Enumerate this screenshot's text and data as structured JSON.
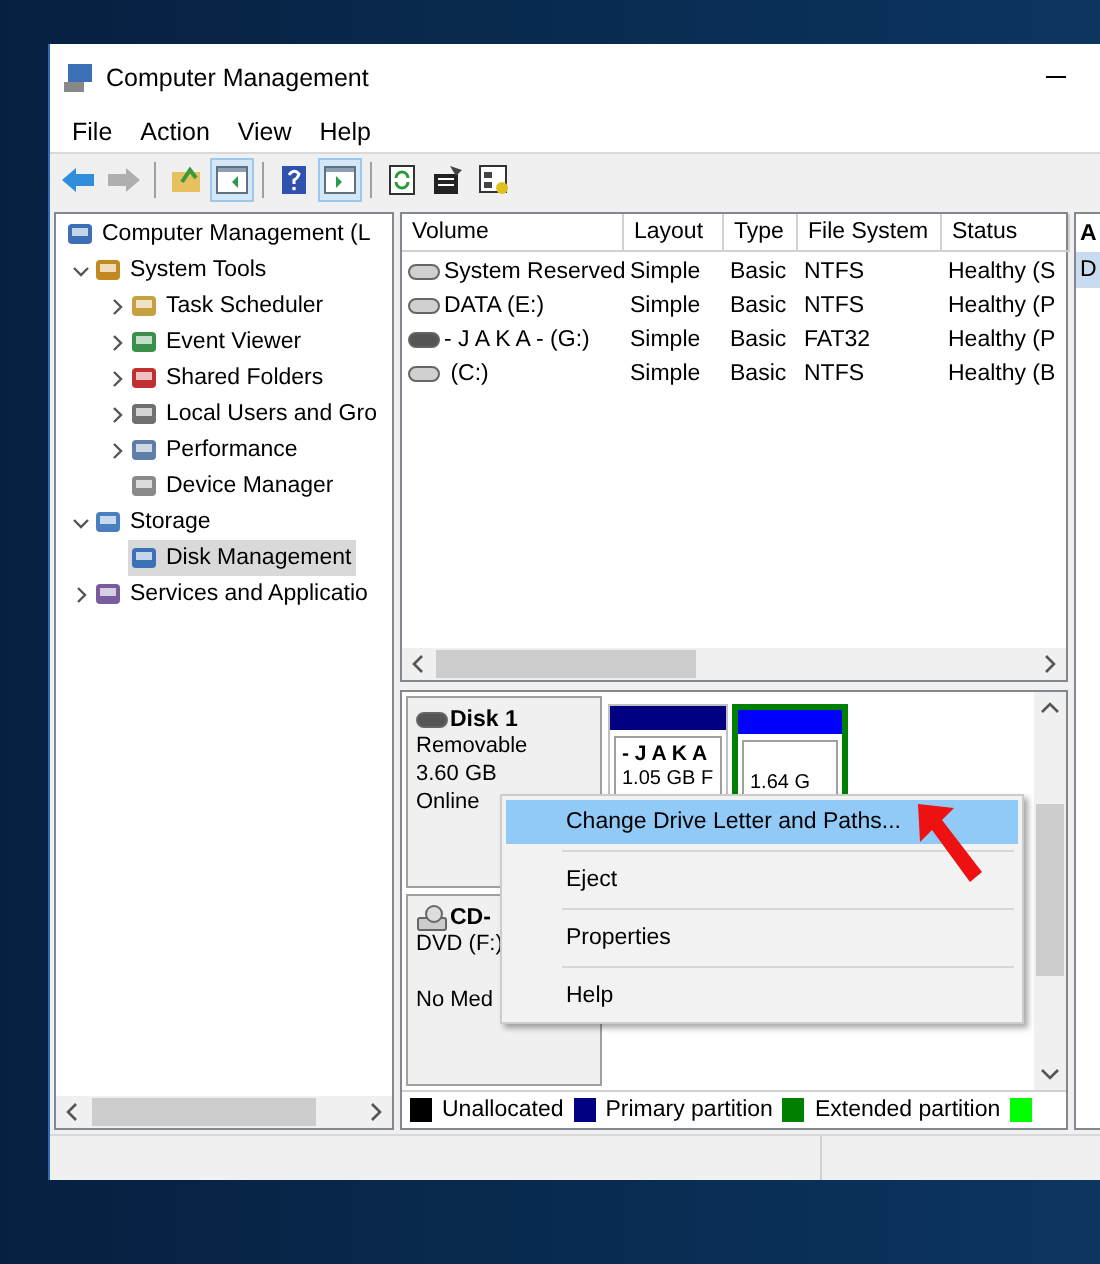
{
  "window": {
    "title": "Computer Management"
  },
  "menu": [
    "File",
    "Action",
    "View",
    "Help"
  ],
  "toolbar": [
    {
      "pressed": false,
      "disabled": false
    },
    {
      "pressed": false,
      "disabled": true
    },
    {
      "pressed": false,
      "disabled": false
    },
    {
      "pressed": true,
      "disabled": false
    },
    {
      "pressed": false,
      "disabled": false
    },
    {
      "pressed": true,
      "disabled": false
    },
    {
      "pressed": false,
      "disabled": false
    },
    {
      "pressed": false,
      "disabled": false
    },
    {
      "pressed": false,
      "disabled": false
    }
  ],
  "tree": [
    {
      "label": "Computer Management (L",
      "selected": false,
      "children": [
        {
          "label": "System Tools",
          "selected": false,
          "expanded": true,
          "children": [
            {
              "label": "Task Scheduler",
              "selected": false,
              "expanded": false
            },
            {
              "label": "Event Viewer",
              "selected": false,
              "expanded": false
            },
            {
              "label": "Shared Folders",
              "selected": false,
              "expanded": false
            },
            {
              "label": "Local Users and Gro",
              "selected": false,
              "expanded": false
            },
            {
              "label": "Performance",
              "selected": false,
              "expanded": false
            },
            {
              "label": "Device Manager",
              "selected": false
            }
          ]
        },
        {
          "label": "Storage",
          "selected": false,
          "expanded": true,
          "children": [
            {
              "label": "Disk Management",
              "selected": true
            }
          ]
        },
        {
          "label": "Services and Applicatio",
          "selected": false,
          "expanded": false
        }
      ]
    }
  ],
  "table": {
    "columns": [
      "Volume",
      "Layout",
      "Type",
      "File System",
      "Status"
    ],
    "rows": [
      {
        "kind": "fixed",
        "cells": [
          "System Reserved",
          "Simple",
          "Basic",
          "NTFS",
          "Healthy (S"
        ]
      },
      {
        "kind": "fixed",
        "cells": [
          "DATA (E:)",
          "Simple",
          "Basic",
          "NTFS",
          "Healthy (P"
        ]
      },
      {
        "kind": "removable",
        "cells": [
          "- J A K A - (G:)",
          "Simple",
          "Basic",
          "FAT32",
          "Healthy (P"
        ]
      },
      {
        "kind": "fixed",
        "cells": [
          " (C:)",
          "Simple",
          "Basic",
          "NTFS",
          "Healthy (B"
        ]
      }
    ]
  },
  "disks": [
    {
      "kind": "removable",
      "name": "Disk 1",
      "lines": [
        "Removable",
        "3.60 GB",
        "Online"
      ],
      "partitions": [
        {
          "kind": "primary",
          "label": "- J A K A",
          "size": "1.05 GB F"
        },
        {
          "kind": "logical",
          "size": "1.64 G"
        }
      ]
    },
    {
      "kind": "cdrom",
      "name": "CD-",
      "lines": [
        "DVD (F:)",
        "No Med"
      ]
    }
  ],
  "legend": [
    {
      "label": "Unallocated",
      "color": "#000000"
    },
    {
      "label": "Primary partition",
      "color": "#000080"
    },
    {
      "label": "Extended partition",
      "color": "#008000"
    },
    {
      "color": "#00ff00"
    }
  ],
  "actions": {
    "header": "A",
    "items": [
      "D"
    ]
  },
  "context_menu": [
    {
      "label": "Change Drive Letter and Paths...",
      "selected": true
    },
    {
      "label": "Eject",
      "selected": false
    },
    {
      "label": "Properties",
      "selected": false
    },
    {
      "label": "Help",
      "selected": false
    }
  ]
}
